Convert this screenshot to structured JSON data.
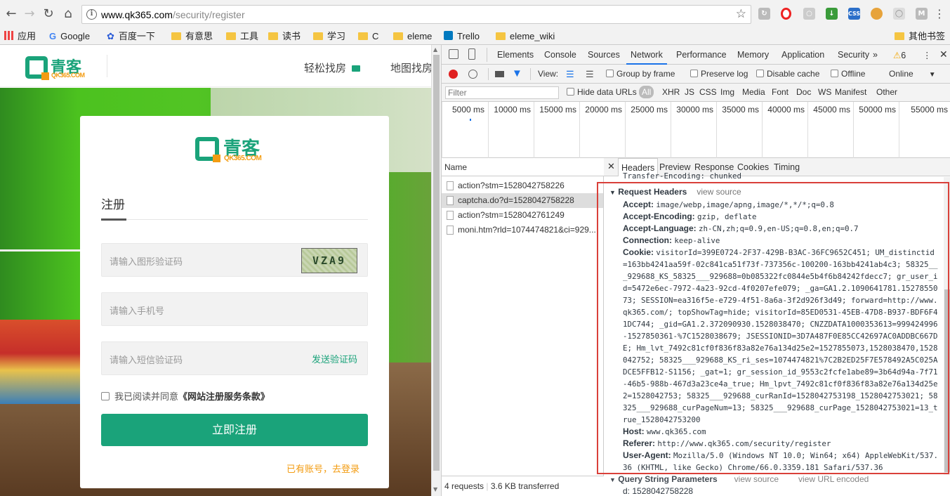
{
  "browser": {
    "url_host": "www.qk365.com",
    "url_path": "/security/register",
    "bookmarks": [
      "应用",
      "Google",
      "百度一下",
      "有意思",
      "工具",
      "读书",
      "学习",
      "C",
      "eleme",
      "Trello",
      "eleme_wiki",
      "其他书签"
    ]
  },
  "site": {
    "logo_cn": "青客",
    "logo_en": "QK365.COM",
    "nav": [
      "轻松找房",
      "地图找房"
    ]
  },
  "form": {
    "title": "注册",
    "captcha_placeholder": "请输入图形验证码",
    "captcha_text": "VZA9",
    "phone_placeholder": "请输入手机号",
    "sms_placeholder": "请输入短信验证码",
    "send_code": "发送验证码",
    "agree_prefix": "我已阅读并同意",
    "agree_terms": "《网站注册服务条款》",
    "submit": "立即注册",
    "login_link": "已有账号，去登录"
  },
  "devtools": {
    "tabs": [
      "Elements",
      "Console",
      "Sources",
      "Network",
      "Performance",
      "Memory",
      "Application",
      "Security"
    ],
    "warnings": "6",
    "toolbar": {
      "view": "View:",
      "group_by_frame": "Group by frame",
      "preserve_log": "Preserve log",
      "disable_cache": "Disable cache",
      "offline": "Offline",
      "throttle": "Online"
    },
    "filter": {
      "placeholder": "Filter",
      "hide_data_urls": "Hide data URLs",
      "types": [
        "All",
        "XHR",
        "JS",
        "CSS",
        "Img",
        "Media",
        "Font",
        "Doc",
        "WS",
        "Manifest",
        "Other"
      ]
    },
    "timeline_ticks": [
      "5000 ms",
      "10000 ms",
      "15000 ms",
      "20000 ms",
      "25000 ms",
      "30000 ms",
      "35000 ms",
      "40000 ms",
      "45000 ms",
      "50000 ms",
      "55000 ms"
    ],
    "list_header": "Name",
    "requests": [
      "action?stm=1528042758226",
      "captcha.do?d=1528042758228",
      "action?stm=1528042761249",
      "moni.htm?rld=1074474821&ci=929..."
    ],
    "status": {
      "requests": "4 requests",
      "transferred": "3.6 KB transferred"
    },
    "detail_tabs": [
      "Headers",
      "Preview",
      "Response",
      "Cookies",
      "Timing"
    ],
    "prev_header": "Transfer-Encoding: chunked",
    "request_headers_title": "Request Headers",
    "view_source": "view source",
    "view_url_encoded": "view URL encoded",
    "query_title": "Query String Parameters",
    "query_d": "d: 1528042758228",
    "headers": [
      {
        "key": "Accept:",
        "lines": [
          "image/webp,image/apng,image/*,*/*;q=0.8"
        ]
      },
      {
        "key": "Accept-Encoding:",
        "lines": [
          "gzip, deflate"
        ]
      },
      {
        "key": "Accept-Language:",
        "lines": [
          "zh-CN,zh;q=0.9,en-US;q=0.8,en;q=0.7"
        ]
      },
      {
        "key": "Connection:",
        "lines": [
          "keep-alive"
        ]
      },
      {
        "key": "Cookie:",
        "lines": [
          "visitorId=399E0724-2F37-429B-B3AC-36FC9652C451; UM_distinctid",
          "=163bb4241aa59f-02c841ca51f73f-737356c-100200-163bb4241ab4c3; 58325__",
          "_929688_KS_58325___929688=0b085322fc0844e5b4f6b84242fdecc7; gr_user_i",
          "d=5472e6ec-7972-4a23-92cd-4f0207efe079; _ga=GA1.2.1090641781.15278550",
          "73; SESSION=ea316f5e-e729-4f51-8a6a-3f2d926f3d49; forward=http://www.",
          "qk365.com/; topShowTag=hide; visitorId=85ED0531-45EB-47D8-B937-BDF6F4",
          "1DC744; _gid=GA1.2.372090930.1528038470; CNZZDATA1000353613=999424996",
          "-1527850361-%7C1528038679; JSESSIONID=3D7A487F0E85CC42697AC0ADDBC667D",
          "E; Hm_lvt_7492c81cf0f836f83a82e76a134d25e2=1527855073,1528038470,1528",
          "042752; 58325___929688_KS_ri_ses=1074474821%7C2B2ED25F7E578492A5C025A",
          "DCE5FFB12-S1156; _gat=1; gr_session_id_9553c2fcfe1abe89=3b64d94a-7f71",
          "-46b5-988b-467d3a23ce4a_true; Hm_lpvt_7492c81cf0f836f83a82e76a134d25e",
          "2=1528042753; 58325___929688_curRanId=1528042753198_1528042753021; 58",
          "325___929688_curPageNum=13; 58325___929688_curPage_1528042753021=13_t",
          "rue_1528042753200"
        ]
      },
      {
        "key": "Host:",
        "lines": [
          "www.qk365.com"
        ]
      },
      {
        "key": "Referer:",
        "lines": [
          "http://www.qk365.com/security/register"
        ]
      },
      {
        "key": "User-Agent:",
        "lines": [
          "Mozilla/5.0 (Windows NT 10.0; Win64; x64) AppleWebKit/537.",
          "36 (KHTML, like Gecko) Chrome/66.0.3359.181 Safari/537.36"
        ]
      }
    ]
  }
}
